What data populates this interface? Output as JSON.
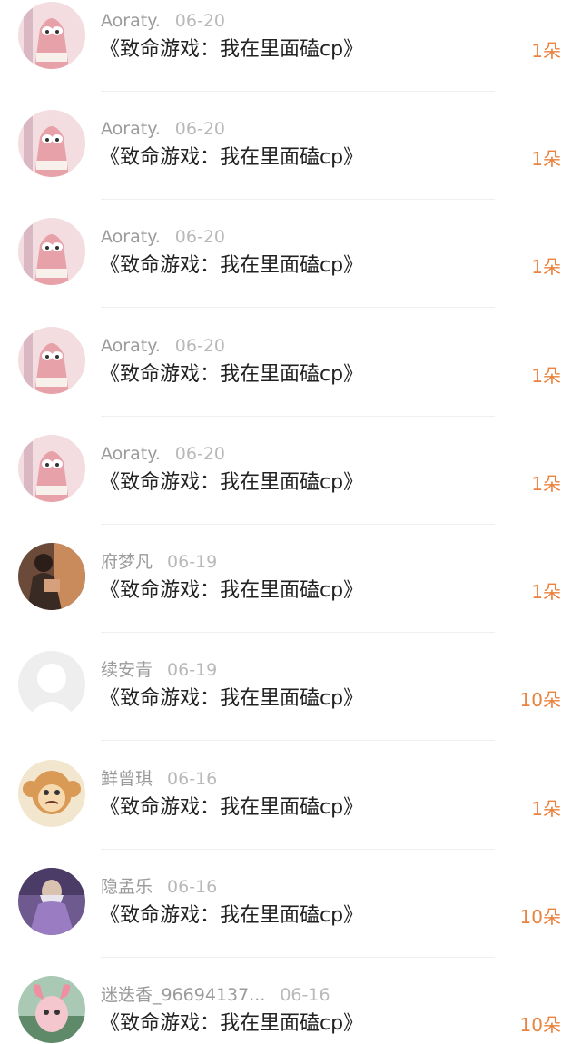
{
  "items": [
    {
      "user": "Aoraty.",
      "date": "06-20",
      "title": "《致命游戏：我在里面磕cp》",
      "gift": "1朵",
      "avatar": "patrick-avatar"
    },
    {
      "user": "Aoraty.",
      "date": "06-20",
      "title": "《致命游戏：我在里面磕cp》",
      "gift": "1朵",
      "avatar": "patrick-avatar"
    },
    {
      "user": "Aoraty.",
      "date": "06-20",
      "title": "《致命游戏：我在里面磕cp》",
      "gift": "1朵",
      "avatar": "patrick-avatar"
    },
    {
      "user": "Aoraty.",
      "date": "06-20",
      "title": "《致命游戏：我在里面磕cp》",
      "gift": "1朵",
      "avatar": "patrick-avatar"
    },
    {
      "user": "Aoraty.",
      "date": "06-20",
      "title": "《致命游戏：我在里面磕cp》",
      "gift": "1朵",
      "avatar": "patrick-avatar"
    },
    {
      "user": "府梦凡",
      "date": "06-19",
      "title": "《致命游戏：我在里面磕cp》",
      "gift": "1朵",
      "avatar": "person-photo-avatar"
    },
    {
      "user": "续安青",
      "date": "06-19",
      "title": "《致命游戏：我在里面磕cp》",
      "gift": "10朵",
      "avatar": "default-user-avatar"
    },
    {
      "user": "鲜曾琪",
      "date": "06-16",
      "title": "《致命游戏：我在里面磕cp》",
      "gift": "1朵",
      "avatar": "monkey-avatar"
    },
    {
      "user": "隐孟乐",
      "date": "06-16",
      "title": "《致命游戏：我在里面磕cp》",
      "gift": "10朵",
      "avatar": "wizard-avatar"
    },
    {
      "user": "迷迭香_96694137...",
      "date": "06-16",
      "title": "《致命游戏：我在里面磕cp》",
      "gift": "10朵",
      "avatar": "pink-creature-avatar"
    }
  ],
  "colors": {
    "gift": "#e8823e",
    "username": "#9b9b9b",
    "date": "#b9b9b9",
    "title": "#222222",
    "divider": "#efefef"
  }
}
